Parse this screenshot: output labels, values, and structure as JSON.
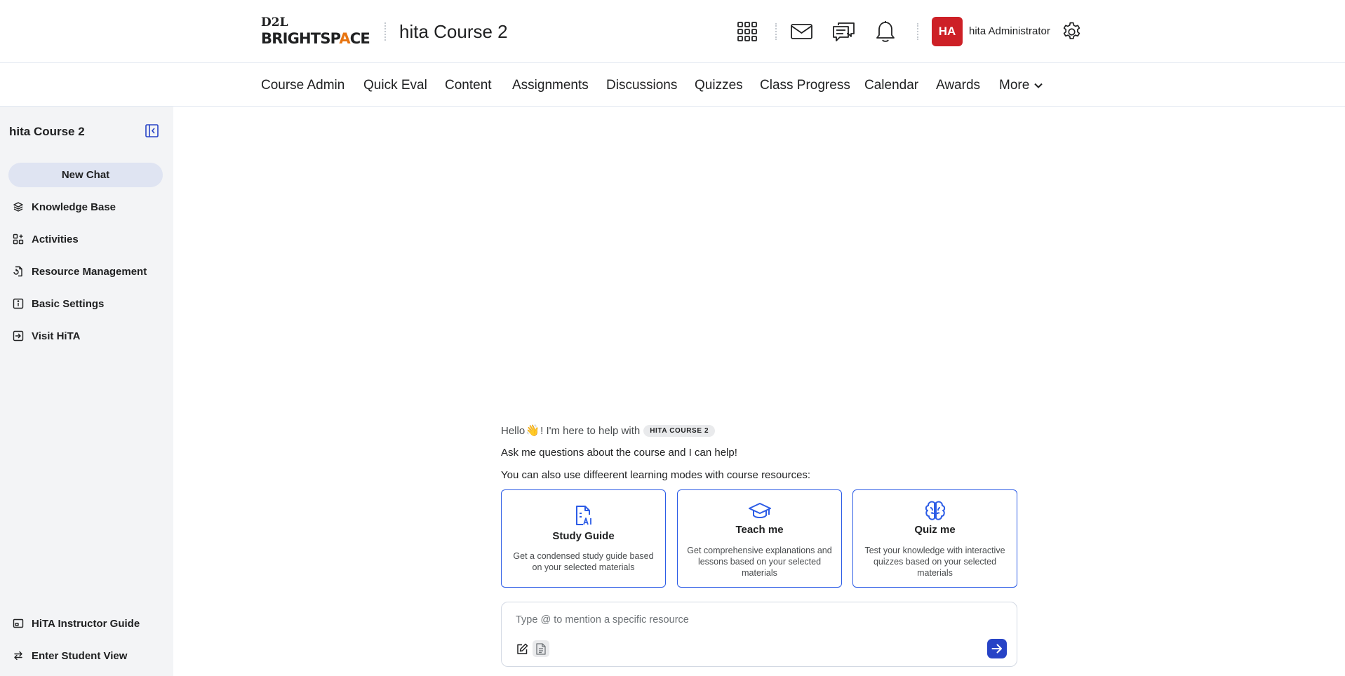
{
  "header": {
    "logo_top": "D2L",
    "logo_bottom_pre": "BRIGHTSP",
    "logo_bottom_accent": "A",
    "logo_bottom_post": "CE",
    "course_title": "hita Course 2",
    "user_initials": "HA",
    "user_name": "hita Administrator",
    "icons": [
      "apps-grid-icon",
      "mail-icon",
      "chat-bubbles-icon",
      "bell-icon",
      "gear-icon"
    ],
    "avatar_color": "#cd2026"
  },
  "nav": {
    "items": [
      "Course Admin",
      "Quick Eval",
      "Content",
      "Assignments",
      "Discussions",
      "Quizzes",
      "Class Progress",
      "Calendar",
      "Awards",
      "More"
    ]
  },
  "sidebar": {
    "title": "hita Course 2",
    "new_chat": "New Chat",
    "items": [
      "Knowledge Base",
      "Activities",
      "Resource Management",
      "Basic Settings",
      "Visit HiTA"
    ],
    "footer_items": [
      "HiTA Instructor Guide",
      "Enter Student View"
    ]
  },
  "chat": {
    "greeting_pre": "Hello",
    "greeting_emoji": "👋",
    "greeting_post": "! I'm here to help with",
    "course_chip": "HITA COURSE 2",
    "line2": "Ask me questions about the course and I can help!",
    "line3": "You can also use diffeerent learning modes with course resources:",
    "cards": [
      {
        "title": "Study Guide",
        "desc": "Get a condensed study guide based on your selected materials",
        "icon": "study-guide-ai-icon"
      },
      {
        "title": "Teach me",
        "desc": "Get comprehensive explanations and lessons based on your selected materials",
        "icon": "graduation-cap-icon"
      },
      {
        "title": "Quiz me",
        "desc": "Test your knowledge with interactive quizzes based on your selected materials",
        "icon": "brain-icon"
      }
    ],
    "input_placeholder": "Type @ to mention a specific resource",
    "accent_color": "#2c5ce6",
    "send_color": "#2743c6"
  }
}
